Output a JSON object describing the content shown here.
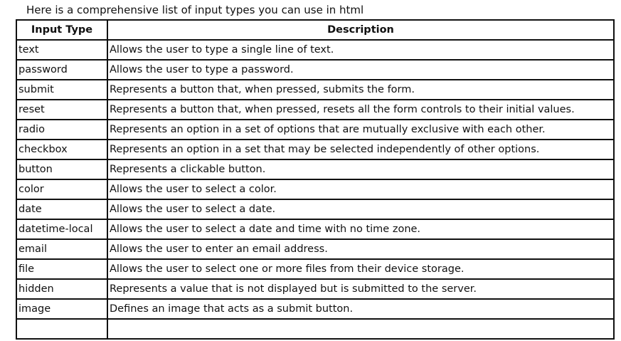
{
  "intro_text": "Here is a comprehensive list of input types you can use in html",
  "table": {
    "headers": [
      "Input Type",
      "Description"
    ],
    "rows": [
      {
        "type": "text",
        "description": "Allows the user to type a single line of text."
      },
      {
        "type": "password",
        "description": "Allows the user to type a password."
      },
      {
        "type": "submit",
        "description": "Represents a button that, when pressed, submits the form."
      },
      {
        "type": "reset",
        "description": "Represents a button that, when pressed, resets all the form controls to their initial values."
      },
      {
        "type": "radio",
        "description": "Represents an option in a set of options that are mutually exclusive with each other."
      },
      {
        "type": "checkbox",
        "description": "Represents an option in a set that may be selected independently of other options."
      },
      {
        "type": "button",
        "description": "Represents a clickable button."
      },
      {
        "type": "color",
        "description": "Allows the user to select a color."
      },
      {
        "type": "date",
        "description": "Allows the user to select a date."
      },
      {
        "type": "datetime-local",
        "description": "Allows the user to select a date and time with no time zone."
      },
      {
        "type": "email",
        "description": "Allows the user to enter an email address."
      },
      {
        "type": "file",
        "description": "Allows the user to select one or more files from their device storage."
      },
      {
        "type": "hidden",
        "description": "Represents a value that is not displayed but is submitted to the server."
      },
      {
        "type": "image",
        "description": "Defines an image that acts as a submit button."
      },
      {
        "type": "",
        "description": ""
      }
    ]
  }
}
